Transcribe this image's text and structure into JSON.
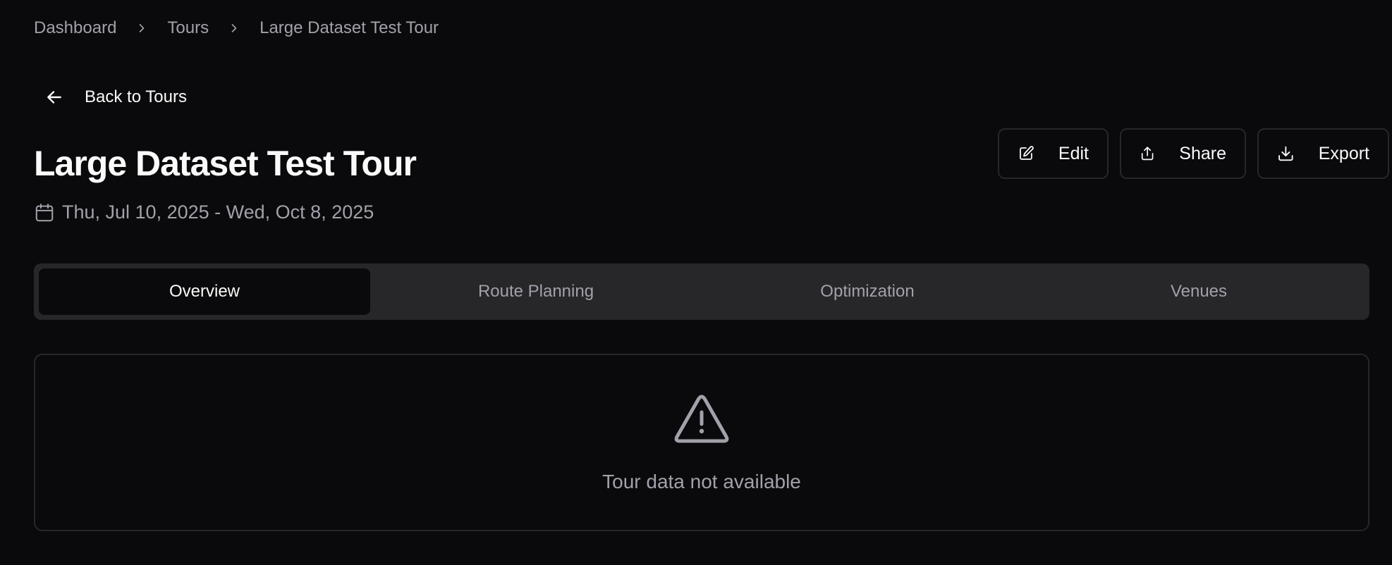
{
  "breadcrumb": {
    "items": [
      "Dashboard",
      "Tours",
      "Large Dataset Test Tour"
    ]
  },
  "back": {
    "label": "Back to Tours",
    "icon": "arrow-left-icon"
  },
  "tour": {
    "title": "Large Dataset Test Tour",
    "date_range": "Thu, Jul 10, 2025 - Wed, Oct 8, 2025"
  },
  "actions": {
    "edit_label": "Edit",
    "share_label": "Share",
    "export_label": "Export"
  },
  "tabs": [
    {
      "label": "Overview",
      "active": true
    },
    {
      "label": "Route Planning",
      "active": false
    },
    {
      "label": "Optimization",
      "active": false
    },
    {
      "label": "Venues",
      "active": false
    }
  ],
  "empty_state": {
    "icon": "warning-triangle-icon",
    "message": "Tour data not available"
  },
  "colors": {
    "background": "#0a0a0c",
    "muted_text": "#a1a1aa",
    "border": "#27272a",
    "tab_bar": "#27272a"
  }
}
